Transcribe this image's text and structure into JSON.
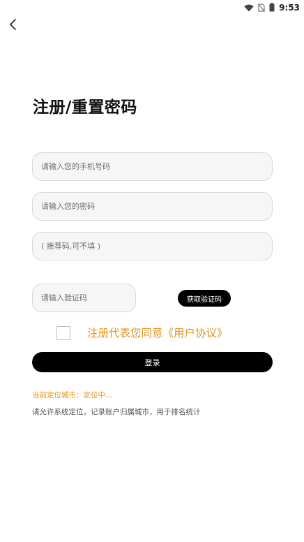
{
  "status_bar": {
    "time": "9:53",
    "icons": [
      "wifi-icon",
      "no-sim-icon",
      "battery-icon"
    ]
  },
  "header": {
    "back_icon": "chevron-left-icon"
  },
  "form": {
    "title": "注册/重置密码",
    "phone_placeholder": "请输入您的手机号码",
    "password_placeholder": "请输入您的密码",
    "referral_placeholder": "( 推荐码,可不填 )",
    "code_placeholder": "请输入验证码",
    "get_code_label": "获取验证码",
    "agreement_text": "注册代表您同意《用户协议》",
    "login_label": "登录"
  },
  "location": {
    "status": "当前定位城市：定位中...",
    "hint": "请允许系统定位，记录账户归属城市，用于排名统计"
  },
  "colors": {
    "accent": "#e2931f",
    "button_bg": "#000000",
    "field_bg": "#f6f6f6",
    "field_border": "#d9d9d9"
  }
}
